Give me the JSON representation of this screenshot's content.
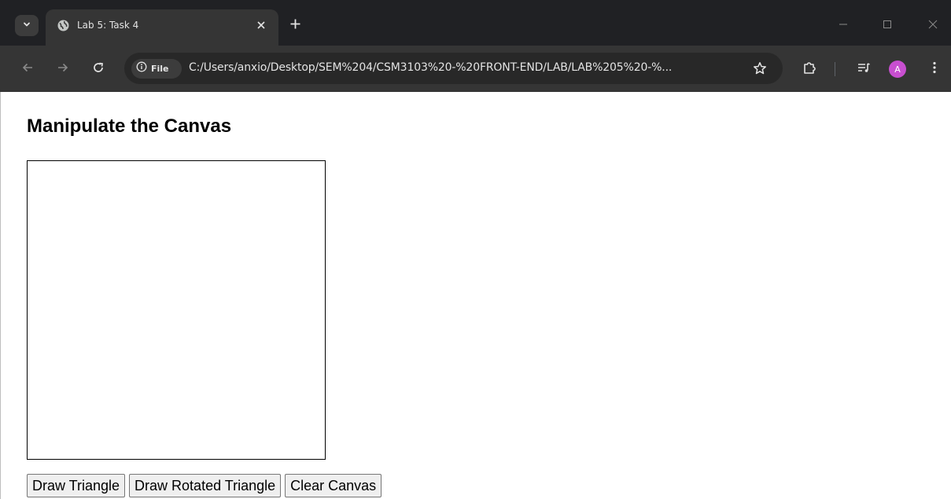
{
  "browser": {
    "tab": {
      "title": "Lab 5: Task 4"
    },
    "omnibox": {
      "chip_label": "File",
      "url": "C:/Users/anxio/Desktop/SEM%204/CSM3103%20-%20FRONT-END/LAB/LAB%205%20-%..."
    },
    "profile_initial": "A",
    "colors": {
      "chrome_bg": "#202124",
      "toolbar_bg": "#353535",
      "avatar": "#c84fd0"
    }
  },
  "page": {
    "title": "Manipulate the Canvas",
    "buttons": {
      "draw_triangle": "Draw Triangle",
      "draw_rotated_triangle": "Draw Rotated Triangle",
      "clear_canvas": "Clear Canvas"
    }
  }
}
